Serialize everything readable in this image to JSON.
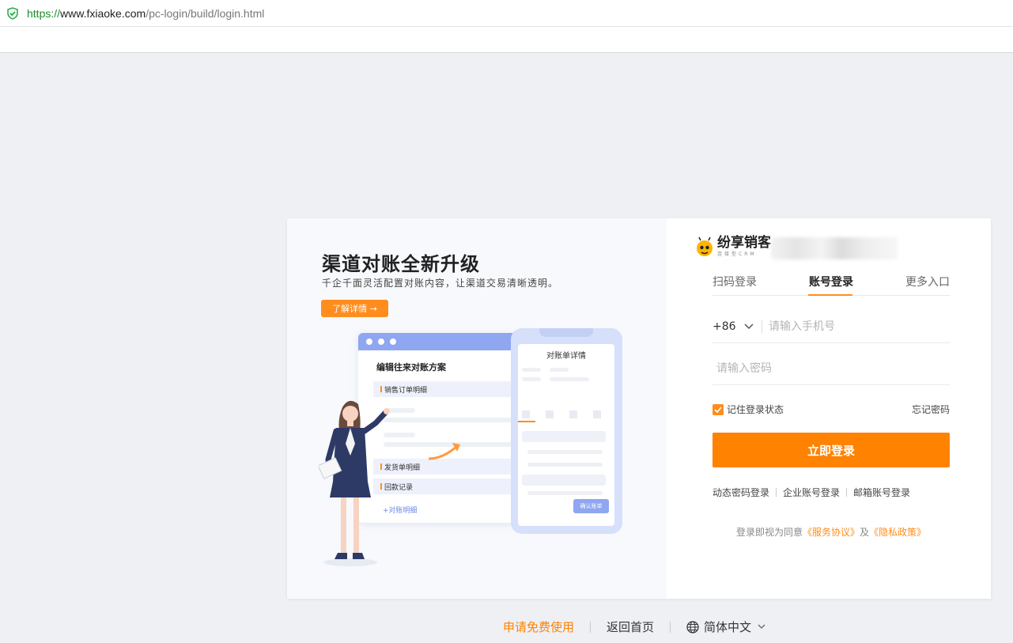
{
  "browser": {
    "url_proto": "https://",
    "url_host": "www.fxiaoke.com",
    "url_path": "/pc-login/build/login.html"
  },
  "promo": {
    "title": "渠道对账全新升级",
    "subtitle": "千企千面灵活配置对账内容，让渠道交易清晰透明。",
    "button": "了解详情 →",
    "desk_title": "编辑往来对账方案",
    "desk_rows": [
      "销售订单明细",
      "发货单明细",
      "回款记录"
    ],
    "desk_add": "+对账明细",
    "phone_title": "对账单详情",
    "phone_button": "确认账单"
  },
  "login": {
    "logo_text": "纷享销客",
    "logo_sub": "连接型CRM",
    "tabs": [
      {
        "label": "扫码登录",
        "active": false
      },
      {
        "label": "账号登录",
        "active": true
      },
      {
        "label": "更多入口",
        "active": false
      }
    ],
    "country_code": "+86",
    "phone_placeholder": "请输入手机号",
    "password_placeholder": "请输入密码",
    "remember_label": "记住登录状态",
    "remember_checked": true,
    "forgot_label": "忘记密码",
    "submit_label": "立即登录",
    "alt_methods": [
      "动态密码登录",
      "企业账号登录",
      "邮箱账号登录"
    ],
    "agree_prefix": "登录即视为同意",
    "service_link": "《服务协议》",
    "agree_and": "及",
    "privacy_link": "《隐私政策》"
  },
  "footer": {
    "trial": "申请免费使用",
    "home": "返回首页",
    "language": "简体中文"
  },
  "colors": {
    "accent": "#ff8200",
    "page_bg": "#eef0f4",
    "illustration_blue": "#8fa6f0"
  }
}
